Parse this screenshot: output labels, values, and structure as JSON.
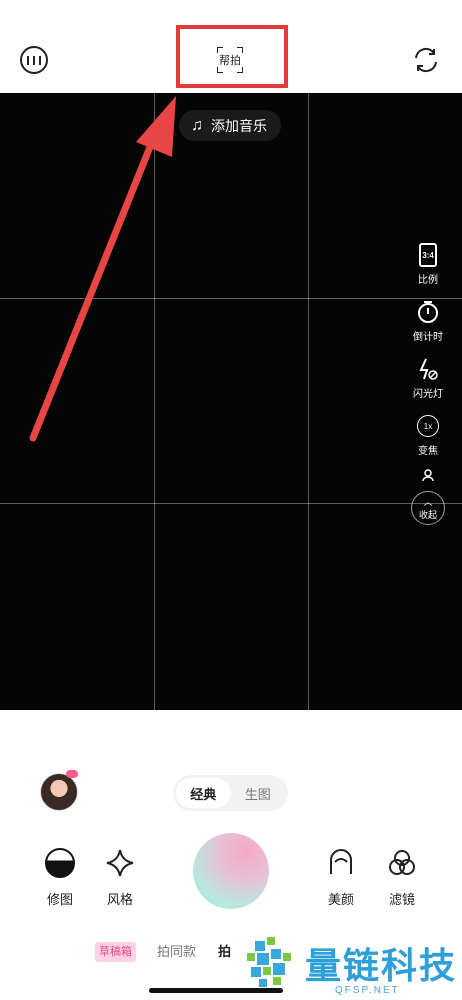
{
  "topbar": {
    "help_label": "帮拍"
  },
  "viewfinder": {
    "music_label": "添加音乐",
    "side_tools": [
      {
        "name": "ratio",
        "icon_text": "3:4",
        "label": "比例"
      },
      {
        "name": "countdown",
        "icon": "timer-icon",
        "label": "倒计时"
      },
      {
        "name": "flash",
        "icon": "flash-off-icon",
        "label": "闪光灯"
      },
      {
        "name": "zoom",
        "icon_text": "1x",
        "label": "变焦"
      },
      {
        "name": "collapse",
        "label": "收起"
      }
    ]
  },
  "panel": {
    "modes": {
      "classic": "经典",
      "generate": "生图"
    },
    "left_controls": [
      {
        "label": "修图",
        "icon": "edit-icon"
      },
      {
        "label": "风格",
        "icon": "sparkle-icon"
      }
    ],
    "right_controls": [
      {
        "label": "美颜",
        "icon": "face-icon"
      },
      {
        "label": "滤镜",
        "icon": "filter-icon"
      }
    ],
    "bottom_tabs": {
      "draft": "草稿箱",
      "same_style": "拍同款",
      "partial": "拍"
    }
  },
  "watermark": {
    "title": "量链科技",
    "subtitle": "QFSP.NET"
  },
  "colors": {
    "highlight": "#e23b3b",
    "status_dot": "#3cc26b",
    "draft_tag_bg": "#ffd1e2",
    "watermark": "#2f9fd8"
  }
}
